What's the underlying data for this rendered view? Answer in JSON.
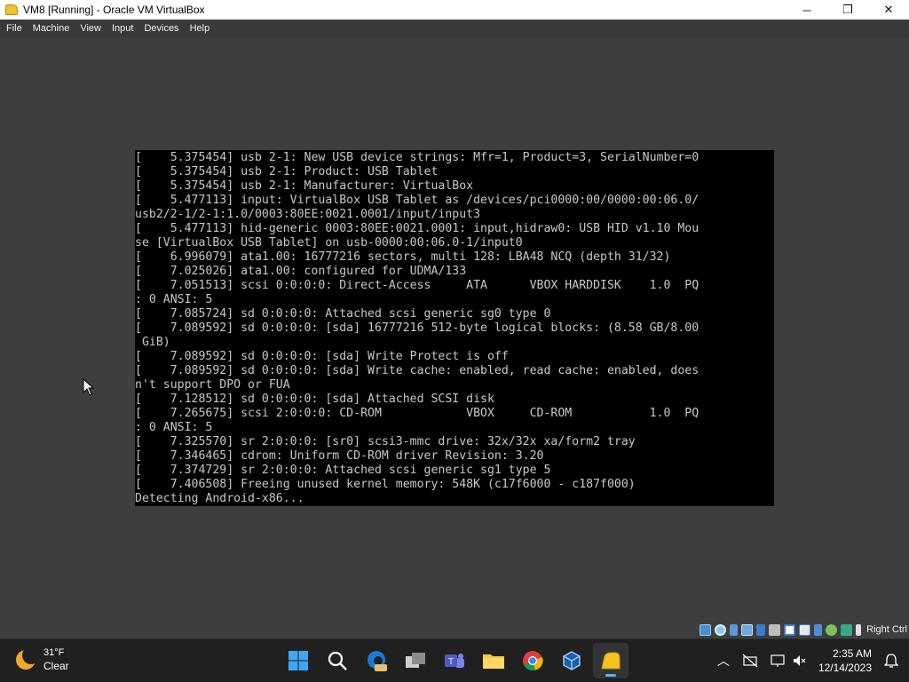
{
  "window": {
    "title": "VM8 [Running] - Oracle VM VirtualBox",
    "minimize": "─",
    "maximize": "❐",
    "close": "✕"
  },
  "menu": [
    "File",
    "Machine",
    "View",
    "Input",
    "Devices",
    "Help"
  ],
  "console": {
    "lines": [
      "[    5.375454] usb 2-1: New USB device strings: Mfr=1, Product=3, SerialNumber=0",
      "[    5.375454] usb 2-1: Product: USB Tablet",
      "[    5.375454] usb 2-1: Manufacturer: VirtualBox",
      "[    5.477113] input: VirtualBox USB Tablet as /devices/pci0000:00/0000:00:06.0/",
      "usb2/2-1/2-1:1.0/0003:80EE:0021.0001/input/input3",
      "[    5.477113] hid-generic 0003:80EE:0021.0001: input,hidraw0: USB HID v1.10 Mou",
      "se [VirtualBox USB Tablet] on usb-0000:00:06.0-1/input0",
      "[    6.996079] ata1.00: 16777216 sectors, multi 128: LBA48 NCQ (depth 31/32)",
      "[    7.025026] ata1.00: configured for UDMA/133",
      "[    7.051513] scsi 0:0:0:0: Direct-Access     ATA      VBOX HARDDISK    1.0  PQ",
      ": 0 ANSI: 5",
      "[    7.085724] sd 0:0:0:0: Attached scsi generic sg0 type 0",
      "[    7.089592] sd 0:0:0:0: [sda] 16777216 512-byte logical blocks: (8.58 GB/8.00",
      " GiB)",
      "[    7.089592] sd 0:0:0:0: [sda] Write Protect is off",
      "[    7.089592] sd 0:0:0:0: [sda] Write cache: enabled, read cache: enabled, does",
      "n't support DPO or FUA",
      "[    7.128512] sd 0:0:0:0: [sda] Attached SCSI disk",
      "[    7.265675] scsi 2:0:0:0: CD-ROM            VBOX     CD-ROM           1.0  PQ",
      ": 0 ANSI: 5",
      "[    7.325570] sr 2:0:0:0: [sr0] scsi3-mmc drive: 32x/32x xa/form2 tray",
      "[    7.346465] cdrom: Uniform CD-ROM driver Revision: 3.20",
      "[    7.374729] sr 2:0:0:0: Attached scsi generic sg1 type 5",
      "[    7.406508] Freeing unused kernel memory: 548K (c17f6000 - c187f000)",
      "Detecting Android-x86..."
    ]
  },
  "status_bar": {
    "host_key": "Right Ctrl",
    "icons": [
      "hard-disk-icon",
      "optical-drive-icon",
      "audio-icon",
      "network-icon",
      "usb-icon",
      "shared-folders-icon",
      "display-icon",
      "recording-icon",
      "vrde-icon",
      "cpu-icon",
      "guest-additions-icon",
      "mouse-integration-icon"
    ]
  },
  "taskbar": {
    "weather_temp": "31°F",
    "weather_cond": "Clear",
    "apps": [
      "start-icon",
      "search-icon",
      "edge-beta-icon",
      "task-view-icon",
      "teams-icon",
      "file-explorer-icon",
      "chrome-icon",
      "virtualbox-icon",
      "virtualbox-vm-icon"
    ],
    "time": "2:35 AM",
    "date": "12/14/2023"
  }
}
